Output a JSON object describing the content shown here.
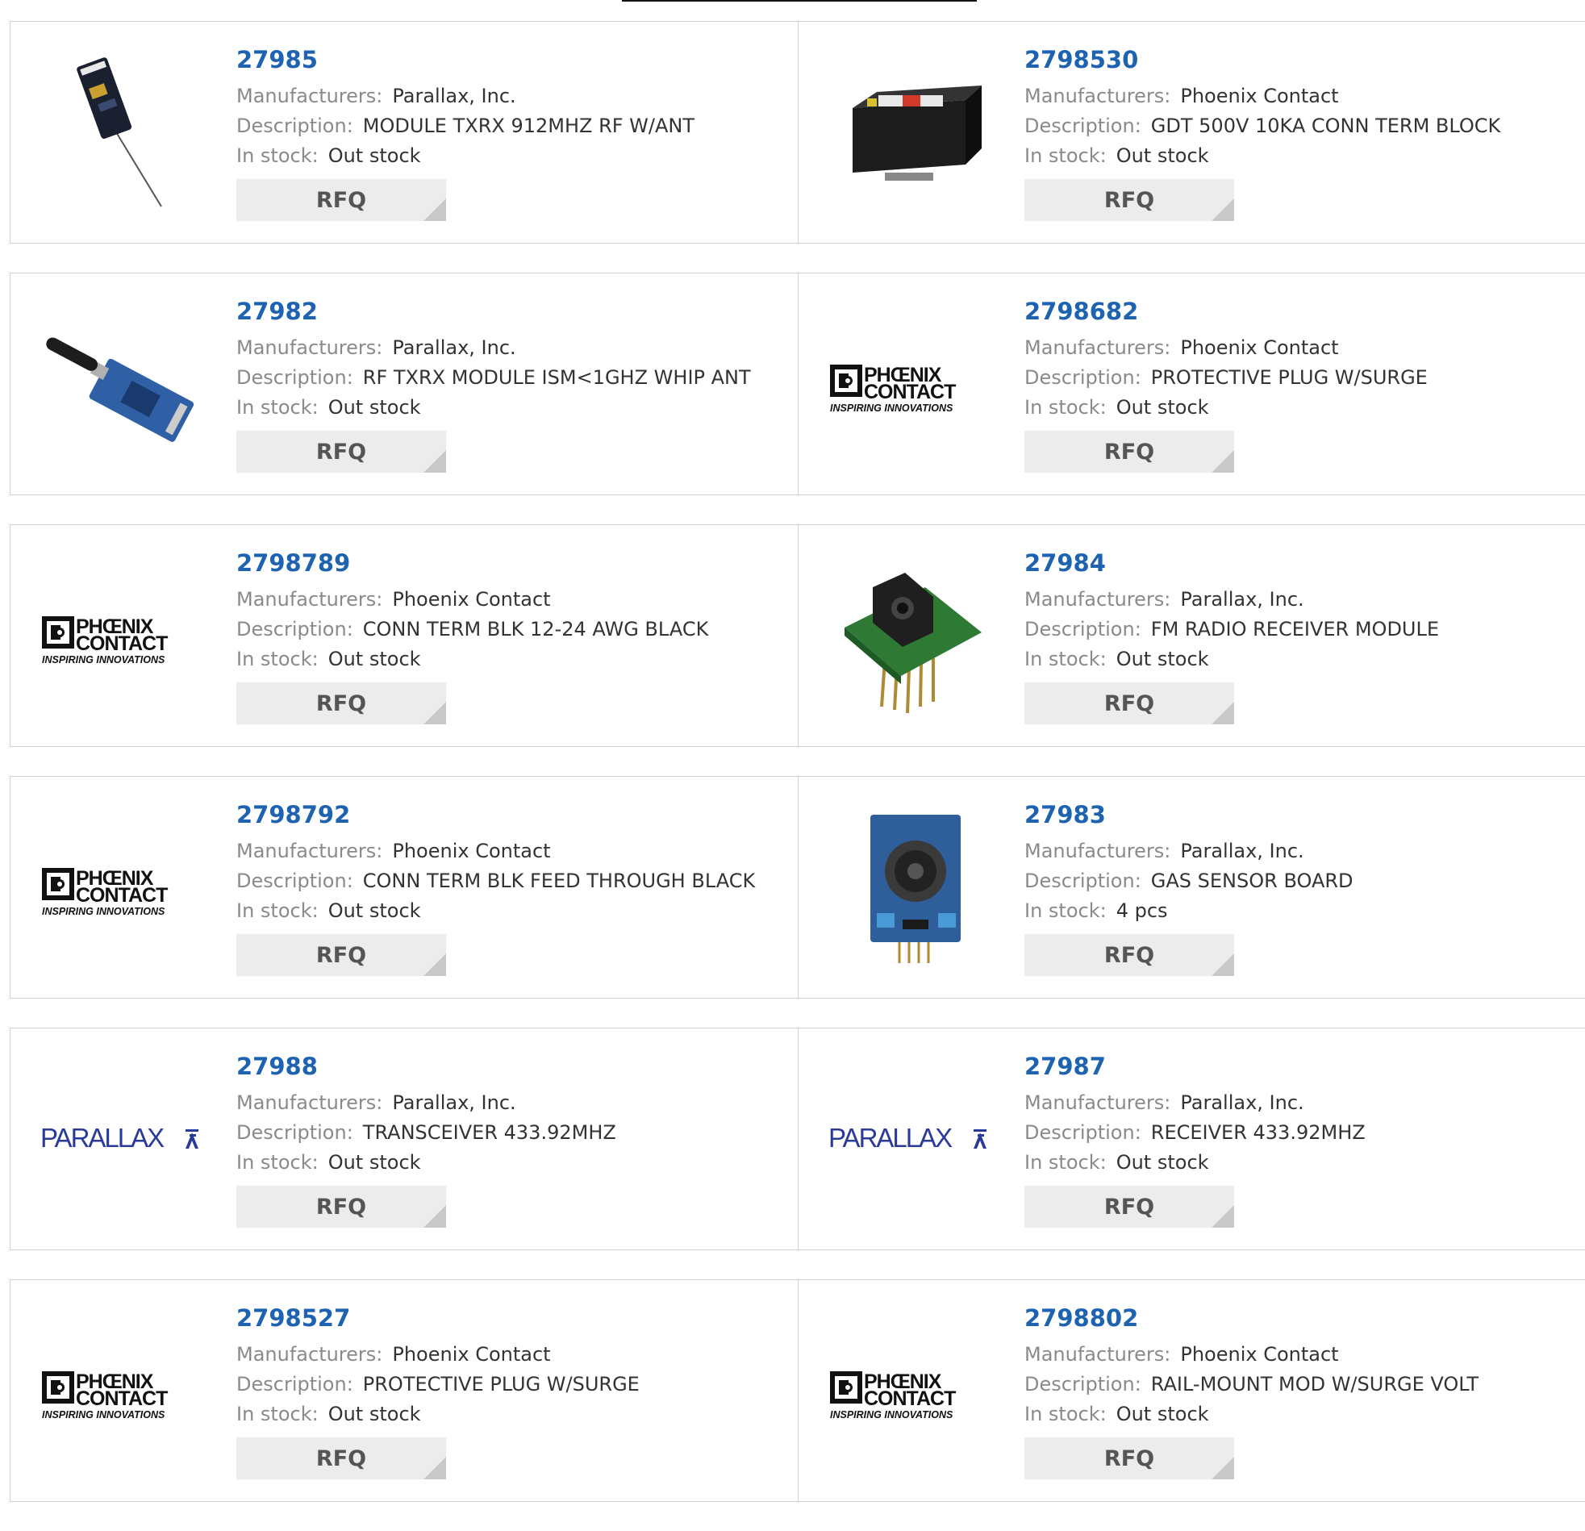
{
  "labels": {
    "manufacturers": "Manufacturers:",
    "description": "Description:",
    "in_stock": "In stock:",
    "rfq": "RFQ"
  },
  "colors": {
    "part_link": "#1e63b0",
    "label": "#8a8a8a",
    "value": "#333333",
    "rfq_bg": "#ececec"
  },
  "products": [
    {
      "part": "27985",
      "manufacturer": "Parallax, Inc.",
      "description": "MODULE TXRX 912MHZ RF W/ANT",
      "stock": "Out stock",
      "image": "rf-module-antenna-photo"
    },
    {
      "part": "2798530",
      "manufacturer": "Phoenix Contact",
      "description": "GDT 500V 10KA CONN TERM BLOCK",
      "stock": "Out stock",
      "image": "terminal-block-photo"
    },
    {
      "part": "27982",
      "manufacturer": "Parallax, Inc.",
      "description": "RF TXRX MODULE ISM<1GHZ WHIP ANT",
      "stock": "Out stock",
      "image": "whip-antenna-module-photo"
    },
    {
      "part": "2798682",
      "manufacturer": "Phoenix Contact",
      "description": "PROTECTIVE PLUG W/SURGE",
      "stock": "Out stock",
      "image": "phoenix-contact-logo"
    },
    {
      "part": "2798789",
      "manufacturer": "Phoenix Contact",
      "description": "CONN TERM BLK 12-24 AWG BLACK",
      "stock": "Out stock",
      "image": "phoenix-contact-logo"
    },
    {
      "part": "27984",
      "manufacturer": "Parallax, Inc.",
      "description": "FM RADIO RECEIVER MODULE",
      "stock": "Out stock",
      "image": "fm-receiver-photo"
    },
    {
      "part": "2798792",
      "manufacturer": "Phoenix Contact",
      "description": "CONN TERM BLK FEED THROUGH BLACK",
      "stock": "Out stock",
      "image": "phoenix-contact-logo"
    },
    {
      "part": "27983",
      "manufacturer": "Parallax, Inc.",
      "description": "GAS SENSOR BOARD",
      "stock": "4 pcs",
      "image": "gas-sensor-board-photo"
    },
    {
      "part": "27988",
      "manufacturer": "Parallax, Inc.",
      "description": "TRANSCEIVER 433.92MHZ",
      "stock": "Out stock",
      "image": "parallax-logo"
    },
    {
      "part": "27987",
      "manufacturer": "Parallax, Inc.",
      "description": "RECEIVER 433.92MHZ",
      "stock": "Out stock",
      "image": "parallax-logo"
    },
    {
      "part": "2798527",
      "manufacturer": "Phoenix Contact",
      "description": "PROTECTIVE PLUG W/SURGE",
      "stock": "Out stock",
      "image": "phoenix-contact-logo"
    },
    {
      "part": "2798802",
      "manufacturer": "Phoenix Contact",
      "description": "RAIL-MOUNT MOD W/SURGE VOLT",
      "stock": "Out stock",
      "image": "phoenix-contact-logo"
    }
  ]
}
